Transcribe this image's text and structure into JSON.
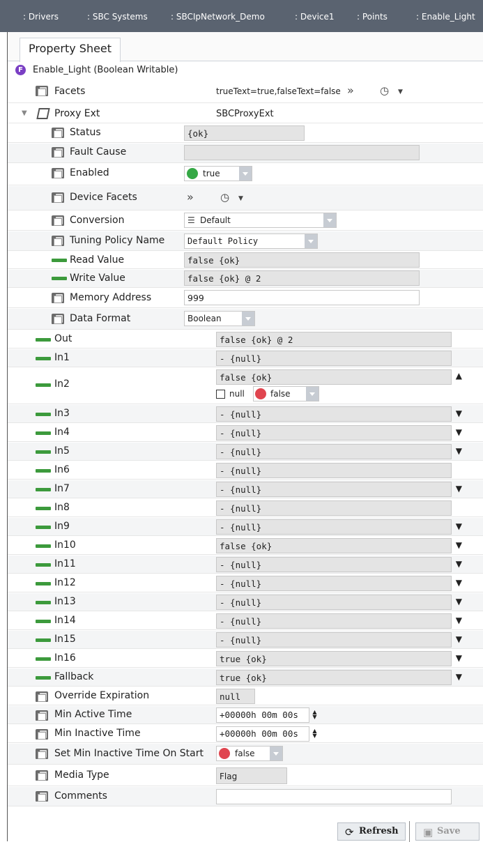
{
  "breadcrumb": {
    "items": [
      ": Drivers",
      ": SBC Systems",
      ": SBCIpNetwork_Demo",
      ": Device1",
      ": Points",
      ": Enable_Light"
    ]
  },
  "tab": {
    "label": "Property Sheet"
  },
  "root": {
    "badge": "F",
    "label": "Enable_Light  (Boolean Writable)"
  },
  "props": {
    "facets": {
      "label": "Facets",
      "value": "trueText=true,falseText=false"
    },
    "proxy_ext": {
      "label": "Proxy Ext",
      "value": "SBCProxyExt"
    },
    "status": {
      "label": "Status",
      "value": "{ok}"
    },
    "fault_cause": {
      "label": "Fault Cause",
      "value": ""
    },
    "enabled": {
      "label": "Enabled",
      "value": "true",
      "color": "#35a845"
    },
    "device_facets": {
      "label": "Device Facets"
    },
    "conversion": {
      "label": "Conversion",
      "value": "Default"
    },
    "tuning_policy": {
      "label": "Tuning Policy Name",
      "value": "Default Policy"
    },
    "read_value": {
      "label": "Read Value",
      "value": "false {ok}"
    },
    "write_value": {
      "label": "Write Value",
      "value": "false {ok} @ 2"
    },
    "memory_address": {
      "label": "Memory Address",
      "value": "999"
    },
    "data_format": {
      "label": "Data Format",
      "value": "Boolean"
    },
    "out": {
      "label": "Out",
      "value": "false {ok} @ 2"
    },
    "in1": {
      "label": "In1",
      "value": "- {null}"
    },
    "in2": {
      "label": "In2",
      "value": "false {ok}",
      "null_label": "null",
      "bool_value": "false",
      "color": "#e0454f"
    },
    "in3": {
      "label": "In3",
      "value": "- {null}"
    },
    "in4": {
      "label": "In4",
      "value": "- {null}"
    },
    "in5": {
      "label": "In5",
      "value": "- {null}"
    },
    "in6": {
      "label": "In6",
      "value": "- {null}"
    },
    "in7": {
      "label": "In7",
      "value": "- {null}"
    },
    "in8": {
      "label": "In8",
      "value": "- {null}"
    },
    "in9": {
      "label": "In9",
      "value": "- {null}"
    },
    "in10": {
      "label": "In10",
      "value": "false {ok}"
    },
    "in11": {
      "label": "In11",
      "value": "- {null}"
    },
    "in12": {
      "label": "In12",
      "value": "- {null}"
    },
    "in13": {
      "label": "In13",
      "value": "- {null}"
    },
    "in14": {
      "label": "In14",
      "value": "- {null}"
    },
    "in15": {
      "label": "In15",
      "value": "- {null}"
    },
    "in16": {
      "label": "In16",
      "value": "true {ok}"
    },
    "fallback": {
      "label": "Fallback",
      "value": "true {ok}"
    },
    "override_expiration": {
      "label": "Override Expiration",
      "value": "null"
    },
    "min_active_time": {
      "label": "Min Active Time",
      "value": "+00000h 00m 00s"
    },
    "min_inactive_time": {
      "label": "Min Inactive Time",
      "value": "+00000h 00m 00s"
    },
    "set_min_inactive": {
      "label": "Set Min Inactive Time On Start",
      "value": "false",
      "color": "#e0454f"
    },
    "media_type": {
      "label": "Media Type",
      "value": "Flag"
    },
    "comments": {
      "label": "Comments",
      "value": ""
    }
  },
  "buttons": {
    "refresh": "Refresh",
    "save": "Save"
  },
  "icons": {
    "expand": "double-chevron-right-icon",
    "history": "clock-icon",
    "sort_up": "arrow-up-icon",
    "sort_down": "arrow-down-icon"
  }
}
